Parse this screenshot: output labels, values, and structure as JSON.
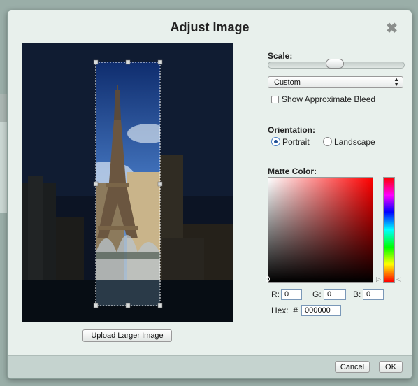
{
  "dialog": {
    "title": "Adjust Image",
    "close_icon": "close-icon"
  },
  "preview": {
    "upload_label": "Upload Larger Image"
  },
  "scale": {
    "label": "Scale:",
    "slider_value": 0.52,
    "select_value": "Custom",
    "show_bleed_label": "Show Approximate Bleed",
    "show_bleed_checked": false
  },
  "orientation": {
    "label": "Orientation:",
    "options": [
      "Portrait",
      "Landscape"
    ],
    "selected": "Portrait"
  },
  "matte": {
    "label": "Matte Color:",
    "r_label": "R:",
    "r_value": "0",
    "g_label": "G:",
    "g_value": "0",
    "b_label": "B:",
    "b_value": "0",
    "hex_label": "Hex:  #",
    "hex_value": "000000",
    "hue_color": "#ff0000"
  },
  "footer": {
    "cancel_label": "Cancel",
    "ok_label": "OK"
  }
}
